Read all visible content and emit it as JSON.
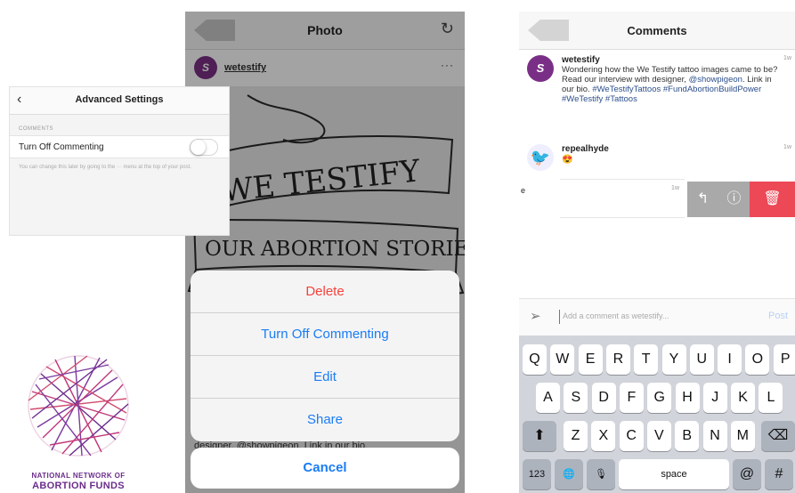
{
  "advanced_settings": {
    "back_icon": "chevron-left-icon",
    "title": "Advanced Settings",
    "section_label": "COMMENTS",
    "toggle_label": "Turn Off Commenting",
    "toggle_state": "off",
    "note": "You can change this later by going to the ··· menu at the top of your post."
  },
  "logo": {
    "line1": "NATIONAL NETWORK OF",
    "line2": "ABORTION FUNDS",
    "color": "#6b2d8b"
  },
  "photo_screen": {
    "title": "Photo",
    "refresh_icon": "refresh-icon",
    "username": "wetestify",
    "avatar_letter": "S",
    "more_icon": "more-icon",
    "banner_top": "WE TESTIFY",
    "banner_bottom": "OUR ABORTION STORIES",
    "caption_fragment": "designer, @showpigeon. Link in our bio.",
    "actions": [
      {
        "label": "Delete",
        "style": "destructive"
      },
      {
        "label": "Turn Off Commenting",
        "style": "default"
      },
      {
        "label": "Edit",
        "style": "default"
      },
      {
        "label": "Share",
        "style": "default"
      }
    ],
    "cancel_label": "Cancel",
    "action_color": "#1a7cf5",
    "destructive_color": "#f4433d"
  },
  "comments_screen": {
    "title": "Comments",
    "comments": [
      {
        "username": "wetestify",
        "avatar_letter": "S",
        "time": "1w",
        "text": "Wondering how the We Testify tattoo images came to be? Read our interview with designer,",
        "mention": "@showpigeon",
        "text_after": ". Link in our bio.",
        "hashtags": "#WeTestifyTattoos #FundAbortionBuildPower #WeTestify #Tattoos"
      },
      {
        "username": "repealhyde",
        "avatar_icon": "bird-icon",
        "time": "1w",
        "text": "😍"
      }
    ],
    "swiped_row": {
      "edge_text": "e",
      "time": "1w",
      "actions": [
        "reply-icon",
        "report-icon",
        "trash-icon"
      ]
    },
    "input": {
      "placeholder": "Add a comment as wetestify...",
      "post_label": "Post",
      "send_icon": "paper-plane-icon"
    },
    "keyboard": {
      "row1": [
        "Q",
        "W",
        "E",
        "R",
        "T",
        "Y",
        "U",
        "I",
        "O",
        "P"
      ],
      "row2": [
        "A",
        "S",
        "D",
        "F",
        "G",
        "H",
        "J",
        "K",
        "L"
      ],
      "row3": [
        "Z",
        "X",
        "C",
        "V",
        "B",
        "N",
        "M"
      ],
      "shift_icon": "shift-icon",
      "delete_icon": "backspace-icon",
      "numbers_label": "123",
      "globe_icon": "globe-icon",
      "mic_icon": "mic-icon",
      "space_label": "space",
      "at_label": "@",
      "hash_label": "#"
    }
  }
}
